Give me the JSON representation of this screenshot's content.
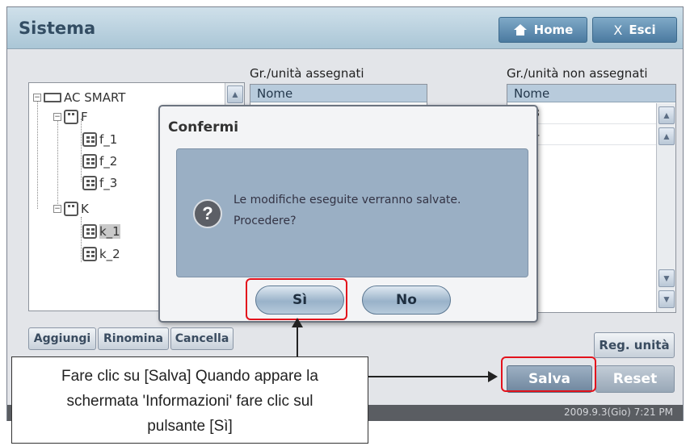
{
  "window": {
    "title": "Sistema",
    "home_label": "Home",
    "exit_label": "Esci"
  },
  "tree": {
    "root": "AC SMART",
    "groups": [
      {
        "label": "F",
        "units": [
          "f_1",
          "f_2",
          "f_3"
        ]
      },
      {
        "label": "K",
        "units": [
          "k_1",
          "k_2"
        ]
      }
    ],
    "selected": "k_1"
  },
  "tree_buttons": {
    "add": "Aggiungi",
    "rename": "Rinomina",
    "delete": "Cancella"
  },
  "assigned": {
    "title": "Gr./unità assegnati",
    "column": "Nome"
  },
  "unassigned": {
    "title": "Gr./unità non assegnati",
    "column": "Nome",
    "rows": [
      "nit-3",
      "nit-4"
    ]
  },
  "buttons": {
    "reg_unit": "Reg. unità",
    "save": "Salva",
    "reset": "Reset"
  },
  "status": {
    "datetime": "2009.9.3(Gio)  7:21 PM"
  },
  "dialog": {
    "title": "Confermi",
    "message_line1": "Le modifiche eseguite verranno salvate.",
    "message_line2": "Procedere?",
    "yes": "Sì",
    "no": "No"
  },
  "callout": {
    "line1": "Fare clic su [Salva] Quando appare la",
    "line2": "schermata 'Informazioni' fare clic sul",
    "line3": "pulsante [Sì]"
  },
  "colors": {
    "highlight": "#e3121c",
    "save_button": "#7f95ab",
    "titlebar": "#aac6d6"
  }
}
